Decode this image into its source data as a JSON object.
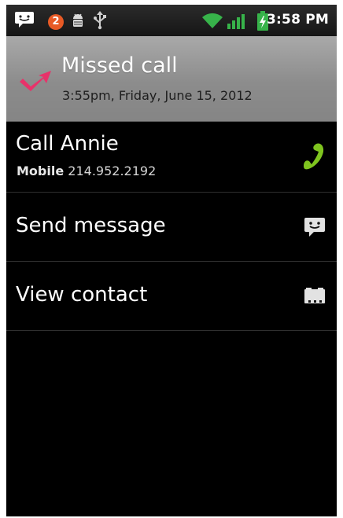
{
  "status_bar": {
    "time": "3:58 PM",
    "notification_count": "2",
    "icons": [
      "sms-icon",
      "notification-badge",
      "android-debug-icon",
      "usb-icon",
      "wifi-icon",
      "signal-icon",
      "battery-charging-icon"
    ]
  },
  "header": {
    "title": "Missed call",
    "subtitle": "3:55pm, Friday, June 15, 2012",
    "icon": "missed-call-icon"
  },
  "menu": {
    "call": {
      "label": "Call Annie",
      "number_type": "Mobile",
      "number": "214.952.2192",
      "icon": "phone-icon"
    },
    "message": {
      "label": "Send message",
      "icon": "message-icon"
    },
    "contact": {
      "label": "View contact",
      "icon": "contact-card-icon"
    }
  },
  "colors": {
    "header_bg": "#999999",
    "phone_icon": "#7fc41f",
    "missed_icon": "#e8326a",
    "background": "#000000"
  }
}
